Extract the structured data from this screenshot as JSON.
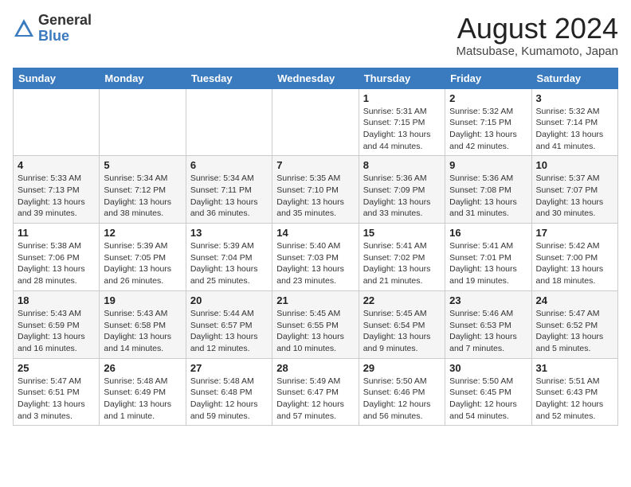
{
  "header": {
    "logo_general": "General",
    "logo_blue": "Blue",
    "month_year": "August 2024",
    "location": "Matsubase, Kumamoto, Japan"
  },
  "days_of_week": [
    "Sunday",
    "Monday",
    "Tuesday",
    "Wednesday",
    "Thursday",
    "Friday",
    "Saturday"
  ],
  "weeks": [
    [
      {
        "day": "",
        "info": ""
      },
      {
        "day": "",
        "info": ""
      },
      {
        "day": "",
        "info": ""
      },
      {
        "day": "",
        "info": ""
      },
      {
        "day": "1",
        "info": "Sunrise: 5:31 AM\nSunset: 7:15 PM\nDaylight: 13 hours\nand 44 minutes."
      },
      {
        "day": "2",
        "info": "Sunrise: 5:32 AM\nSunset: 7:15 PM\nDaylight: 13 hours\nand 42 minutes."
      },
      {
        "day": "3",
        "info": "Sunrise: 5:32 AM\nSunset: 7:14 PM\nDaylight: 13 hours\nand 41 minutes."
      }
    ],
    [
      {
        "day": "4",
        "info": "Sunrise: 5:33 AM\nSunset: 7:13 PM\nDaylight: 13 hours\nand 39 minutes."
      },
      {
        "day": "5",
        "info": "Sunrise: 5:34 AM\nSunset: 7:12 PM\nDaylight: 13 hours\nand 38 minutes."
      },
      {
        "day": "6",
        "info": "Sunrise: 5:34 AM\nSunset: 7:11 PM\nDaylight: 13 hours\nand 36 minutes."
      },
      {
        "day": "7",
        "info": "Sunrise: 5:35 AM\nSunset: 7:10 PM\nDaylight: 13 hours\nand 35 minutes."
      },
      {
        "day": "8",
        "info": "Sunrise: 5:36 AM\nSunset: 7:09 PM\nDaylight: 13 hours\nand 33 minutes."
      },
      {
        "day": "9",
        "info": "Sunrise: 5:36 AM\nSunset: 7:08 PM\nDaylight: 13 hours\nand 31 minutes."
      },
      {
        "day": "10",
        "info": "Sunrise: 5:37 AM\nSunset: 7:07 PM\nDaylight: 13 hours\nand 30 minutes."
      }
    ],
    [
      {
        "day": "11",
        "info": "Sunrise: 5:38 AM\nSunset: 7:06 PM\nDaylight: 13 hours\nand 28 minutes."
      },
      {
        "day": "12",
        "info": "Sunrise: 5:39 AM\nSunset: 7:05 PM\nDaylight: 13 hours\nand 26 minutes."
      },
      {
        "day": "13",
        "info": "Sunrise: 5:39 AM\nSunset: 7:04 PM\nDaylight: 13 hours\nand 25 minutes."
      },
      {
        "day": "14",
        "info": "Sunrise: 5:40 AM\nSunset: 7:03 PM\nDaylight: 13 hours\nand 23 minutes."
      },
      {
        "day": "15",
        "info": "Sunrise: 5:41 AM\nSunset: 7:02 PM\nDaylight: 13 hours\nand 21 minutes."
      },
      {
        "day": "16",
        "info": "Sunrise: 5:41 AM\nSunset: 7:01 PM\nDaylight: 13 hours\nand 19 minutes."
      },
      {
        "day": "17",
        "info": "Sunrise: 5:42 AM\nSunset: 7:00 PM\nDaylight: 13 hours\nand 18 minutes."
      }
    ],
    [
      {
        "day": "18",
        "info": "Sunrise: 5:43 AM\nSunset: 6:59 PM\nDaylight: 13 hours\nand 16 minutes."
      },
      {
        "day": "19",
        "info": "Sunrise: 5:43 AM\nSunset: 6:58 PM\nDaylight: 13 hours\nand 14 minutes."
      },
      {
        "day": "20",
        "info": "Sunrise: 5:44 AM\nSunset: 6:57 PM\nDaylight: 13 hours\nand 12 minutes."
      },
      {
        "day": "21",
        "info": "Sunrise: 5:45 AM\nSunset: 6:55 PM\nDaylight: 13 hours\nand 10 minutes."
      },
      {
        "day": "22",
        "info": "Sunrise: 5:45 AM\nSunset: 6:54 PM\nDaylight: 13 hours\nand 9 minutes."
      },
      {
        "day": "23",
        "info": "Sunrise: 5:46 AM\nSunset: 6:53 PM\nDaylight: 13 hours\nand 7 minutes."
      },
      {
        "day": "24",
        "info": "Sunrise: 5:47 AM\nSunset: 6:52 PM\nDaylight: 13 hours\nand 5 minutes."
      }
    ],
    [
      {
        "day": "25",
        "info": "Sunrise: 5:47 AM\nSunset: 6:51 PM\nDaylight: 13 hours\nand 3 minutes."
      },
      {
        "day": "26",
        "info": "Sunrise: 5:48 AM\nSunset: 6:49 PM\nDaylight: 13 hours\nand 1 minute."
      },
      {
        "day": "27",
        "info": "Sunrise: 5:48 AM\nSunset: 6:48 PM\nDaylight: 12 hours\nand 59 minutes."
      },
      {
        "day": "28",
        "info": "Sunrise: 5:49 AM\nSunset: 6:47 PM\nDaylight: 12 hours\nand 57 minutes."
      },
      {
        "day": "29",
        "info": "Sunrise: 5:50 AM\nSunset: 6:46 PM\nDaylight: 12 hours\nand 56 minutes."
      },
      {
        "day": "30",
        "info": "Sunrise: 5:50 AM\nSunset: 6:45 PM\nDaylight: 12 hours\nand 54 minutes."
      },
      {
        "day": "31",
        "info": "Sunrise: 5:51 AM\nSunset: 6:43 PM\nDaylight: 12 hours\nand 52 minutes."
      }
    ]
  ]
}
